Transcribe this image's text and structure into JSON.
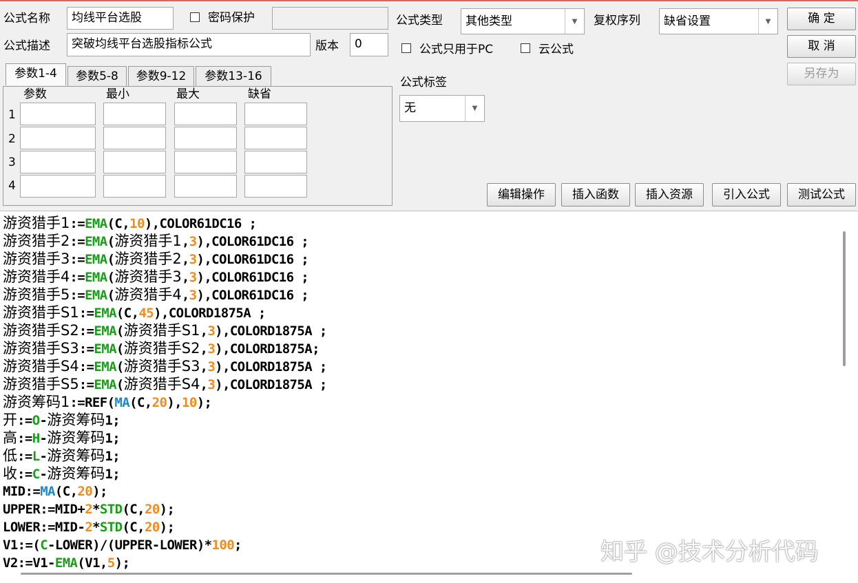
{
  "header": {
    "name_label": "公式名称",
    "name_value": "均线平台选股",
    "password_label": "密码保护",
    "password_value": "",
    "desc_label": "公式描述",
    "desc_value": "突破均线平台选股指标公式",
    "version_label": "版本",
    "version_value": "0",
    "type_label": "公式类型",
    "type_value": "其他类型",
    "copyright_label": "复权序列",
    "copyright_value": "缺省设置",
    "pc_only_label": "公式只用于PC",
    "cloud_label": "云公式",
    "tag_label": "公式标签",
    "tag_value": "无"
  },
  "buttons": {
    "ok": "确  定",
    "cancel": "取  消",
    "save_as": "另存为",
    "edit_ops": "编辑操作",
    "insert_func": "插入函数",
    "insert_res": "插入资源",
    "import_formula": "引入公式",
    "test_formula": "测试公式"
  },
  "params": {
    "tabs": [
      "参数1-4",
      "参数5-8",
      "参数9-12",
      "参数13-16"
    ],
    "active_tab": 0,
    "columns": [
      "参数",
      "最小",
      "最大",
      "缺省"
    ],
    "rows": [
      "1",
      "2",
      "3",
      "4"
    ]
  },
  "code_lines": [
    [
      [
        "t",
        "游资猎手1"
      ],
      [
        "p",
        ":="
      ],
      [
        "f",
        "EMA"
      ],
      [
        "p",
        "(C,"
      ],
      [
        "n",
        "10"
      ],
      [
        "p",
        "),COLOR61DC16 ;"
      ]
    ],
    [
      [
        "t",
        "游资猎手2"
      ],
      [
        "p",
        ":="
      ],
      [
        "f",
        "EMA"
      ],
      [
        "p",
        "("
      ],
      [
        "t",
        "游资猎手1"
      ],
      [
        "p",
        ","
      ],
      [
        "n",
        "3"
      ],
      [
        "p",
        "),COLOR61DC16 ;"
      ]
    ],
    [
      [
        "t",
        "游资猎手3"
      ],
      [
        "p",
        ":="
      ],
      [
        "f",
        "EMA"
      ],
      [
        "p",
        "("
      ],
      [
        "t",
        "游资猎手2"
      ],
      [
        "p",
        ","
      ],
      [
        "n",
        "3"
      ],
      [
        "p",
        "),COLOR61DC16 ;"
      ]
    ],
    [
      [
        "t",
        "游资猎手4"
      ],
      [
        "p",
        ":="
      ],
      [
        "f",
        "EMA"
      ],
      [
        "p",
        "("
      ],
      [
        "t",
        "游资猎手3"
      ],
      [
        "p",
        ","
      ],
      [
        "n",
        "3"
      ],
      [
        "p",
        "),COLOR61DC16 ;"
      ]
    ],
    [
      [
        "t",
        "游资猎手5"
      ],
      [
        "p",
        ":="
      ],
      [
        "f",
        "EMA"
      ],
      [
        "p",
        "("
      ],
      [
        "t",
        "游资猎手4"
      ],
      [
        "p",
        ","
      ],
      [
        "n",
        "3"
      ],
      [
        "p",
        "),COLOR61DC16 ;"
      ]
    ],
    [
      [
        "t",
        "游资猎手S1"
      ],
      [
        "p",
        ":="
      ],
      [
        "f",
        "EMA"
      ],
      [
        "p",
        "(C,"
      ],
      [
        "n",
        "45"
      ],
      [
        "p",
        "),COLORD1875A ;"
      ]
    ],
    [
      [
        "t",
        "游资猎手S2"
      ],
      [
        "p",
        ":="
      ],
      [
        "f",
        "EMA"
      ],
      [
        "p",
        "("
      ],
      [
        "t",
        "游资猎手S1"
      ],
      [
        "p",
        ","
      ],
      [
        "n",
        "3"
      ],
      [
        "p",
        "),COLORD1875A ;"
      ]
    ],
    [
      [
        "t",
        "游资猎手S3"
      ],
      [
        "p",
        ":="
      ],
      [
        "f",
        "EMA"
      ],
      [
        "p",
        "("
      ],
      [
        "t",
        "游资猎手S2"
      ],
      [
        "p",
        ","
      ],
      [
        "n",
        "3"
      ],
      [
        "p",
        "),COLORD1875A;"
      ]
    ],
    [
      [
        "t",
        "游资猎手S4"
      ],
      [
        "p",
        ":="
      ],
      [
        "f",
        "EMA"
      ],
      [
        "p",
        "("
      ],
      [
        "t",
        "游资猎手S3"
      ],
      [
        "p",
        ","
      ],
      [
        "n",
        "3"
      ],
      [
        "p",
        "),COLORD1875A ;"
      ]
    ],
    [
      [
        "t",
        "游资猎手S5"
      ],
      [
        "p",
        ":="
      ],
      [
        "f",
        "EMA"
      ],
      [
        "p",
        "("
      ],
      [
        "t",
        "游资猎手S4"
      ],
      [
        "p",
        ","
      ],
      [
        "n",
        "3"
      ],
      [
        "p",
        "),COLORD1875A ;"
      ]
    ],
    [
      [
        "t",
        "游资筹码1"
      ],
      [
        "p",
        ":="
      ],
      [
        "p",
        "REF("
      ],
      [
        "b",
        "MA"
      ],
      [
        "p",
        "(C,"
      ],
      [
        "n",
        "20"
      ],
      [
        "p",
        "),"
      ],
      [
        "n",
        "10"
      ],
      [
        "p",
        ");"
      ]
    ],
    [
      [
        "t",
        "开"
      ],
      [
        "p",
        ":="
      ],
      [
        "f",
        "O"
      ],
      [
        "p",
        "-"
      ],
      [
        "t",
        "游资筹码"
      ],
      [
        "p",
        "1;"
      ]
    ],
    [
      [
        "t",
        "高"
      ],
      [
        "p",
        ":="
      ],
      [
        "f",
        "H"
      ],
      [
        "p",
        "-"
      ],
      [
        "t",
        "游资筹码"
      ],
      [
        "p",
        "1;"
      ]
    ],
    [
      [
        "t",
        "低"
      ],
      [
        "p",
        ":="
      ],
      [
        "f",
        "L"
      ],
      [
        "p",
        "-"
      ],
      [
        "t",
        "游资筹码"
      ],
      [
        "p",
        "1;"
      ]
    ],
    [
      [
        "t",
        "收"
      ],
      [
        "p",
        ":="
      ],
      [
        "f",
        "C"
      ],
      [
        "p",
        "-"
      ],
      [
        "t",
        "游资筹码"
      ],
      [
        "p",
        "1;"
      ]
    ],
    [
      [
        "p",
        "MID:="
      ],
      [
        "b",
        "MA"
      ],
      [
        "p",
        "(C,"
      ],
      [
        "n",
        "20"
      ],
      [
        "p",
        ");"
      ]
    ],
    [
      [
        "p",
        "UPPER:=MID+"
      ],
      [
        "n",
        "2"
      ],
      [
        "p",
        "*"
      ],
      [
        "f",
        "STD"
      ],
      [
        "p",
        "(C,"
      ],
      [
        "n",
        "20"
      ],
      [
        "p",
        ");"
      ]
    ],
    [
      [
        "p",
        "LOWER:=MID-"
      ],
      [
        "n",
        "2"
      ],
      [
        "p",
        "*"
      ],
      [
        "f",
        "STD"
      ],
      [
        "p",
        "(C,"
      ],
      [
        "n",
        "20"
      ],
      [
        "p",
        ");"
      ]
    ],
    [
      [
        "p",
        "V1:=("
      ],
      [
        "f",
        "C"
      ],
      [
        "p",
        "-LOWER)/(UPPER-LOWER)*"
      ],
      [
        "n",
        "100"
      ],
      [
        "p",
        ";"
      ]
    ],
    [
      [
        "p",
        "V2:=V1-"
      ],
      [
        "f",
        "EMA"
      ],
      [
        "p",
        "(V1,"
      ],
      [
        "n",
        "5"
      ],
      [
        "p",
        ");"
      ]
    ]
  ],
  "watermark": "知乎 @技术分析代码",
  "colors": {
    "function_green": "#1a9e1a",
    "function_blue": "#1e88c8",
    "number_orange": "#f08c1e",
    "window_bg": "#f0f0f0"
  }
}
